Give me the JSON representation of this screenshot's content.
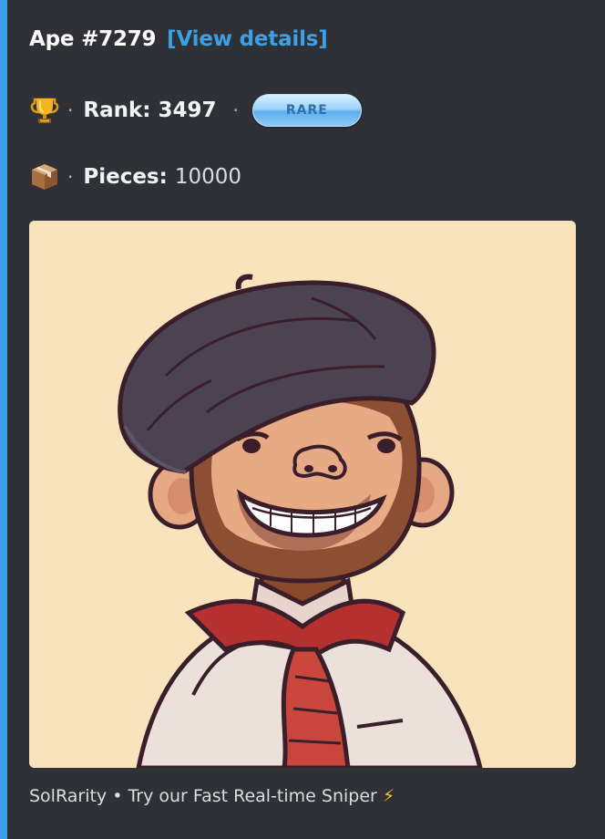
{
  "embed": {
    "accent_color": "#3ba0e6",
    "title": "Ape #7279",
    "details_link": "[View details]",
    "rank": {
      "icon": "trophy-icon",
      "label": "Rank:",
      "value": "3497",
      "badge": "RARE"
    },
    "pieces": {
      "icon": "package-icon",
      "label": "Pieces:",
      "value": "10000"
    },
    "separator": "·",
    "image": {
      "description_icon": "ape-nft-image",
      "background": "#f9e3bd"
    },
    "footer": {
      "text": "SolRarity • Try our Fast Real-time Sniper",
      "icon": "lightning-icon",
      "emoji": "⚡"
    }
  }
}
